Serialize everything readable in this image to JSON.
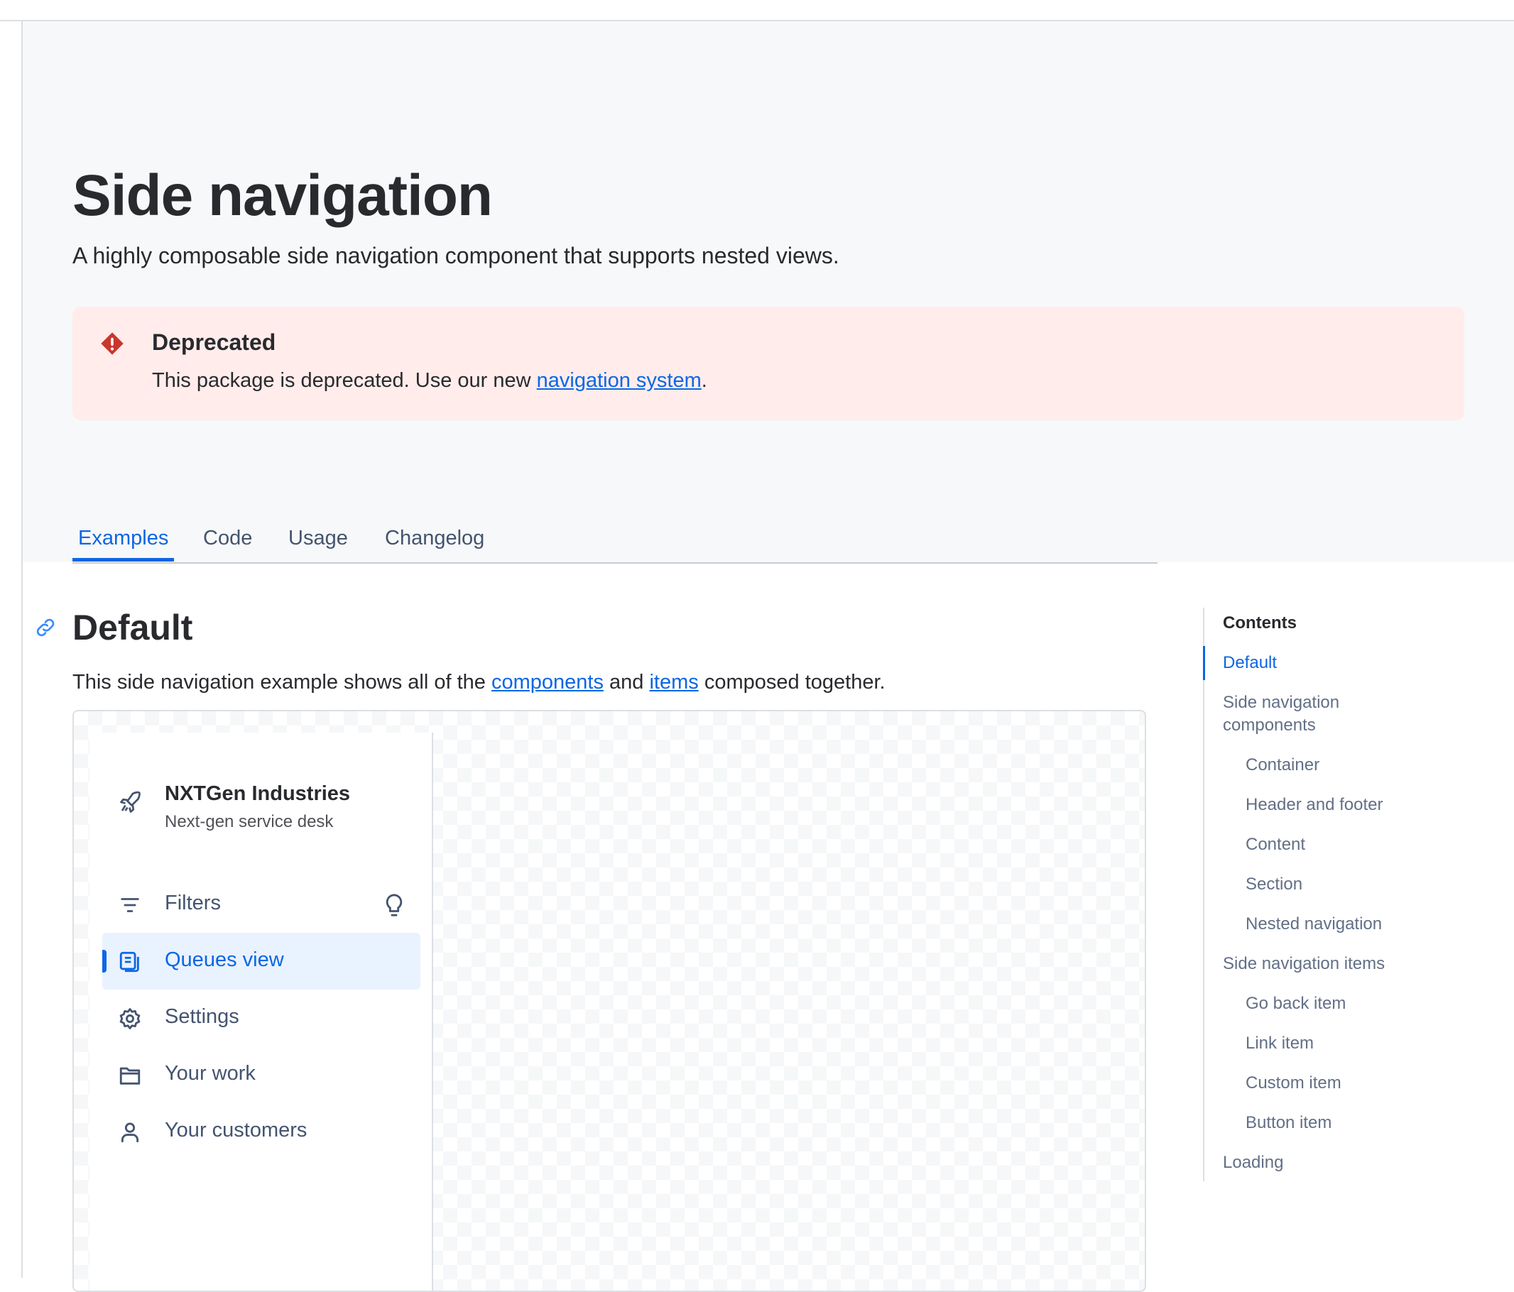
{
  "page": {
    "title": "Side navigation",
    "subtitle": "A highly composable side navigation component that supports nested views."
  },
  "banner": {
    "title": "Deprecated",
    "text_before": "This package is deprecated. Use our new ",
    "link": "navigation system",
    "text_after": ".",
    "color": "#ffeceb",
    "icon": "error-diamond-icon"
  },
  "tabs": [
    {
      "label": "Examples",
      "active": true
    },
    {
      "label": "Code"
    },
    {
      "label": "Usage"
    },
    {
      "label": "Changelog"
    }
  ],
  "section": {
    "heading": "Default",
    "text_before": "This side navigation example shows all of the ",
    "link1": "components",
    "text_mid": " and ",
    "link2": "items",
    "text_after": " composed together."
  },
  "example_nav": {
    "header_title": "NXTGen Industries",
    "header_subtitle": "Next-gen service desk",
    "items": [
      {
        "label": "Filters",
        "icon": "filter-icon",
        "after_icon": "lightbulb-icon"
      },
      {
        "label": "Queues view",
        "icon": "queues-icon",
        "active": true
      },
      {
        "label": "Settings",
        "icon": "gear-icon"
      },
      {
        "label": "Your work",
        "icon": "folder-icon"
      },
      {
        "label": "Your customers",
        "icon": "person-icon"
      }
    ]
  },
  "toc": {
    "title": "Contents",
    "items": [
      {
        "label": "Default",
        "active": true
      },
      {
        "label": "Side navigation components"
      },
      {
        "label": "Container"
      },
      {
        "label": "Header and footer"
      },
      {
        "label": "Content"
      },
      {
        "label": "Section"
      },
      {
        "label": "Nested navigation"
      },
      {
        "label": "Side navigation items"
      },
      {
        "label": "Go back item"
      },
      {
        "label": "Link item"
      },
      {
        "label": "Custom item"
      },
      {
        "label": "Button item"
      },
      {
        "label": "Loading"
      }
    ]
  },
  "colors": {
    "accent": "#0c66e4",
    "danger": "#c9372c",
    "hero_bg": "#f7f8f9",
    "text": "#292a2e"
  }
}
